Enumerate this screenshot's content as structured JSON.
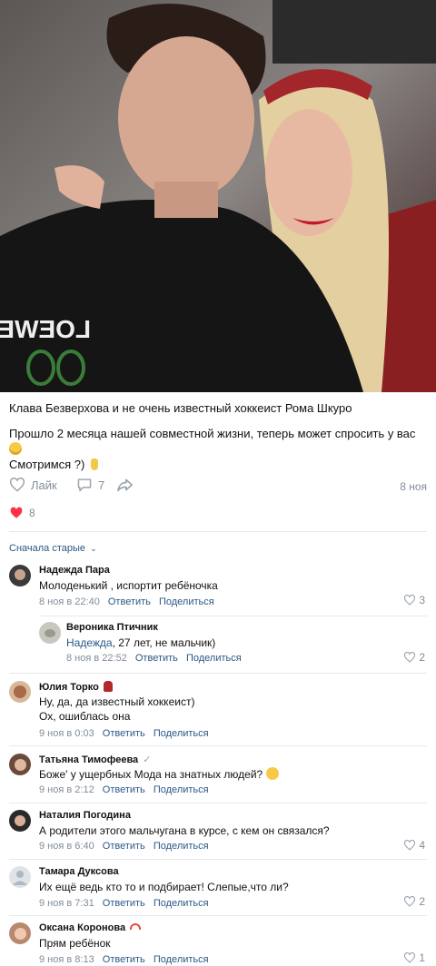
{
  "post": {
    "title": "Клава Безверхова и не очень известный хоккеист Рома Шкуро",
    "line1": "Прошло 2 месяца нашей совместной жизни, теперь может спросить у вас",
    "line2": "Смотримся ?)",
    "shirt_text": "LOEWE"
  },
  "actions": {
    "like_label": "Лайк",
    "comments_count": "7",
    "date": "8 ноя"
  },
  "likes": {
    "count": "8"
  },
  "sort_label": "Сначала старые",
  "comments": [
    {
      "name": "Надежда Пара",
      "text": "Молоденький , испортит ребёночка",
      "date": "8 ноя в 22:40",
      "reply": "Ответить",
      "share": "Поделиться",
      "likes": "3"
    },
    {
      "name": "Вероника Птичник",
      "reply_to": "Надежда",
      "text": ", 27 лет, не мальчик)",
      "date": "8 ноя в 22:52",
      "reply": "Ответить",
      "share": "Поделиться",
      "likes": "2"
    },
    {
      "name": "Юлия Торко",
      "text": "Ну, да, да известный хоккеист)",
      "text2": "Ох, ошиблась она",
      "date": "9 ноя в 0:03",
      "reply": "Ответить",
      "share": "Поделиться"
    },
    {
      "name": "Татьяна Тимофеева",
      "text": "Боже' у ущербных Мода на знатных людей?",
      "date": "9 ноя в 2:12",
      "reply": "Ответить",
      "share": "Поделиться"
    },
    {
      "name": "Наталия Погодина",
      "text": "А родители этого мальчугана в курсе, с кем он связался?",
      "date": "9 ноя в 6:40",
      "reply": "Ответить",
      "share": "Поделиться",
      "likes": "4"
    },
    {
      "name": "Тамара Дуксова",
      "text": "Их ещё ведь кто то и подбирает! Слепые,что ли?",
      "date": "9 ноя в 7:31",
      "reply": "Ответить",
      "share": "Поделиться",
      "likes": "2"
    },
    {
      "name": "Оксана Коронова",
      "text": "Прям ребёнок",
      "date": "9 ноя в 8:13",
      "reply": "Ответить",
      "share": "Поделиться",
      "likes": "1"
    }
  ],
  "colors": {
    "link": "#2a5885",
    "meta": "#818c99",
    "heart": "#ff3347",
    "divider": "#e7e8ec"
  }
}
